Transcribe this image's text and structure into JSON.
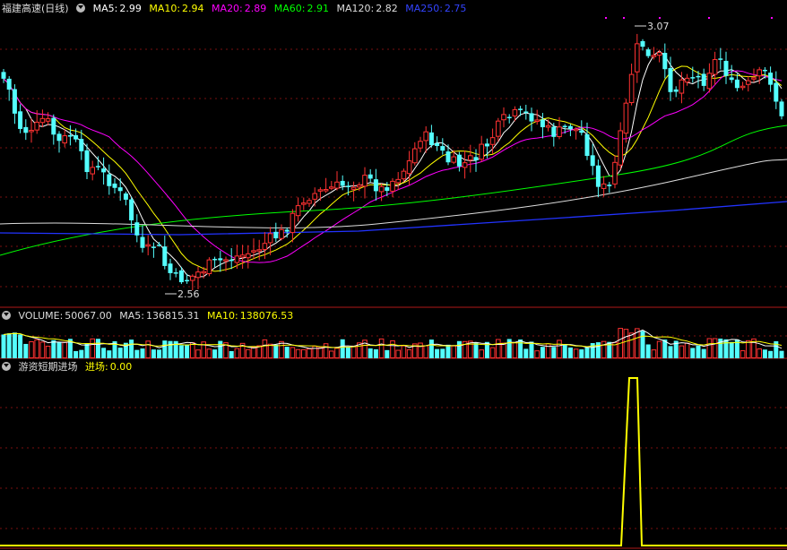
{
  "stock": {
    "name": "福建高速",
    "period": "(日线)"
  },
  "main_indicators": [
    {
      "label": "MA5:",
      "value": "2.99",
      "color": "#ffffff"
    },
    {
      "label": "MA10:",
      "value": "2.94",
      "color": "#ffff00"
    },
    {
      "label": "MA20:",
      "value": "2.89",
      "color": "#ff00ff"
    },
    {
      "label": "MA60:",
      "value": "2.91",
      "color": "#00ff00"
    },
    {
      "label": "MA120:",
      "value": "2.82",
      "color": "#ffffff"
    },
    {
      "label": "MA250:",
      "value": "2.75",
      "color": "#3344ff"
    }
  ],
  "annotations": {
    "high": "3.07",
    "low": "2.56"
  },
  "volume_panel": {
    "label": "VOLUME:",
    "value": "50067.00",
    "ma5_label": "MA5:",
    "ma5_value": "136815.31",
    "ma10_label": "MA10:",
    "ma10_value": "138076.53"
  },
  "signal_panel": {
    "name": "游资短期进场",
    "label": "进场:",
    "value": "0.00"
  },
  "colors": {
    "up": "#ff3232",
    "down": "#54ffff",
    "grid": "#7a1010",
    "divider": "#b01818"
  }
}
